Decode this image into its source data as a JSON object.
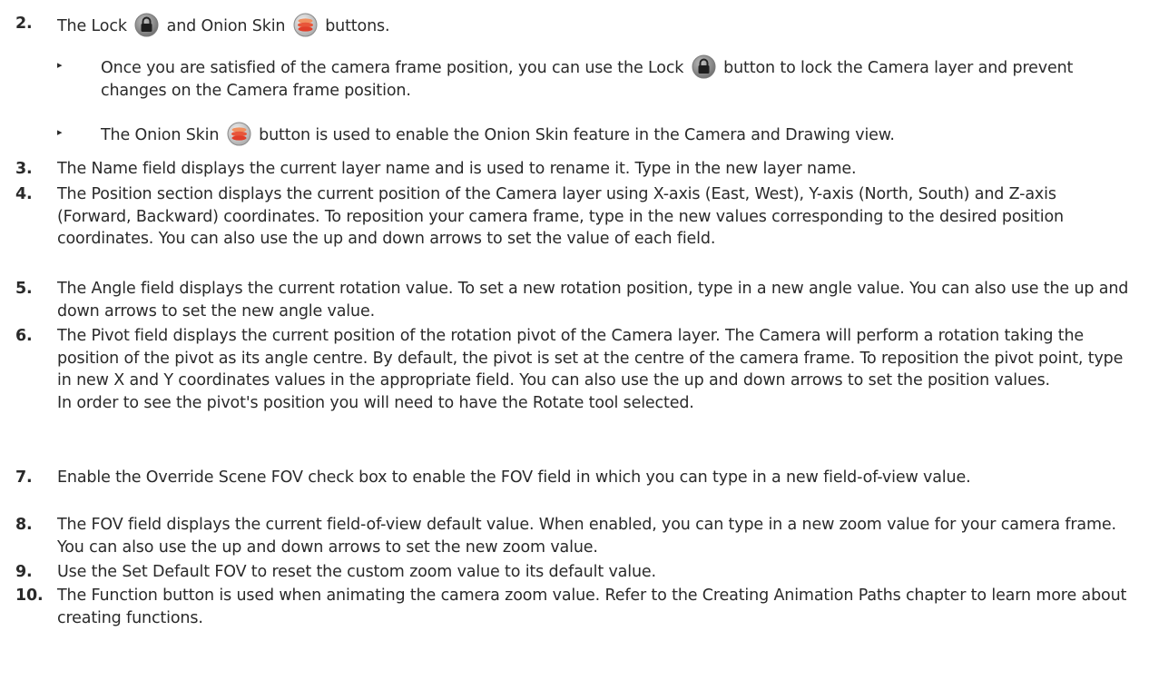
{
  "items": [
    {
      "number": "2.",
      "text_before": "The Lock",
      "text_middle": "and Onion Skin",
      "text_after": "buttons."
    },
    {
      "bullet": "▸",
      "text_before": "Once you are satisfied of the camera frame position, you can use the Lock",
      "text_after": "button to lock the Camera layer and prevent changes on the Camera frame position."
    },
    {
      "bullet": "▸",
      "text_before": "The Onion Skin",
      "text_after": "button is used to enable the Onion Skin feature in the Camera and Drawing view."
    },
    {
      "number": "3.",
      "text": "The Name field displays the current layer name and is used to rename it. Type in the new layer name."
    },
    {
      "number": "4.",
      "text": "The Position section displays the current position of the Camera layer using X-axis (East, West), Y-axis (North, South) and Z-axis (Forward, Backward) coordinates. To reposition your camera frame, type in the new values corresponding to the desired position coordinates. You can also use the up and down arrows to set the value of each field."
    },
    {
      "number": "5.",
      "text": "The Angle field displays the current rotation value. To set a new rotation position, type in a new angle value. You can also use the up and down arrows to set the new angle value."
    },
    {
      "number": "6.",
      "text": "The Pivot field displays the current position of the rotation pivot of the Camera layer. The Camera will perform a rotation taking the position of the pivot as its angle centre. By default, the pivot is set at the centre of the camera frame. To reposition the pivot point, type in new X and Y coordinates values in the appropriate field. You can also use the up and down arrows to set the position values.",
      "text2": "In order to see the pivot's position you will need to have the Rotate tool selected."
    },
    {
      "number": "7.",
      "text": "Enable the Override Scene FOV check box to enable the FOV field in which you can type in a new field-of-view value."
    },
    {
      "number": "8.",
      "text": "The FOV field displays the current field-of-view default value. When enabled, you can type in a new zoom value for your camera frame. You can also use the up and down arrows to set the new zoom value."
    },
    {
      "number": "9.",
      "text": "Use the Set Default FOV to reset the custom zoom value to its default value."
    },
    {
      "number": "10.",
      "text": "The Function button is used when animating the camera zoom value. Refer to the Creating Animation Paths chapter to learn more about creating functions."
    }
  ],
  "icons": {
    "lock": "lock-icon",
    "onion_skin": "onion-skin-icon"
  }
}
